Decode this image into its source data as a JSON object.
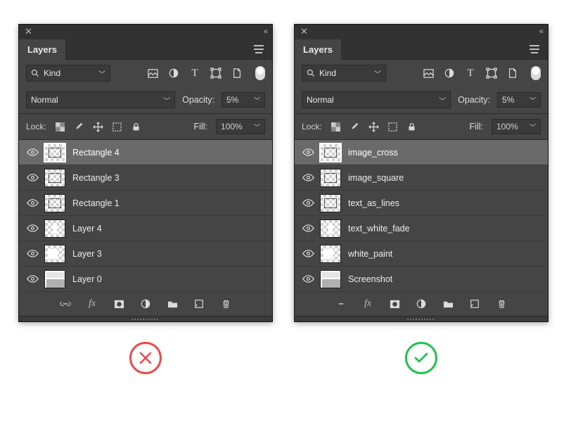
{
  "panel_title": "Layers",
  "filter": {
    "label": "Kind"
  },
  "blend": {
    "mode": "Normal",
    "opacity_label": "Opacity:",
    "opacity_value": "5%"
  },
  "lock": {
    "label": "Lock:",
    "fill_label": "Fill:",
    "fill_value": "100%"
  },
  "left": {
    "layers": [
      {
        "name": "Rectangle 4",
        "thumb": "chk-sel",
        "selected": true
      },
      {
        "name": "Rectangle 3",
        "thumb": "chk-rect"
      },
      {
        "name": "Rectangle 1",
        "thumb": "chk-rect"
      },
      {
        "name": "Layer 4",
        "thumb": "chk-center"
      },
      {
        "name": "Layer 3",
        "thumb": "chk-half"
      },
      {
        "name": "Layer 0",
        "thumb": "screenshot"
      }
    ]
  },
  "right": {
    "layers": [
      {
        "name": "image_cross",
        "thumb": "chk-sel",
        "selected": true
      },
      {
        "name": "image_square",
        "thumb": "chk-rect"
      },
      {
        "name": "text_as_lines",
        "thumb": "chk-rect"
      },
      {
        "name": "text_white_fade",
        "thumb": "chk-center"
      },
      {
        "name": "white_paint",
        "thumb": "chk-half"
      },
      {
        "name": "Screenshot",
        "thumb": "screenshot"
      }
    ]
  }
}
